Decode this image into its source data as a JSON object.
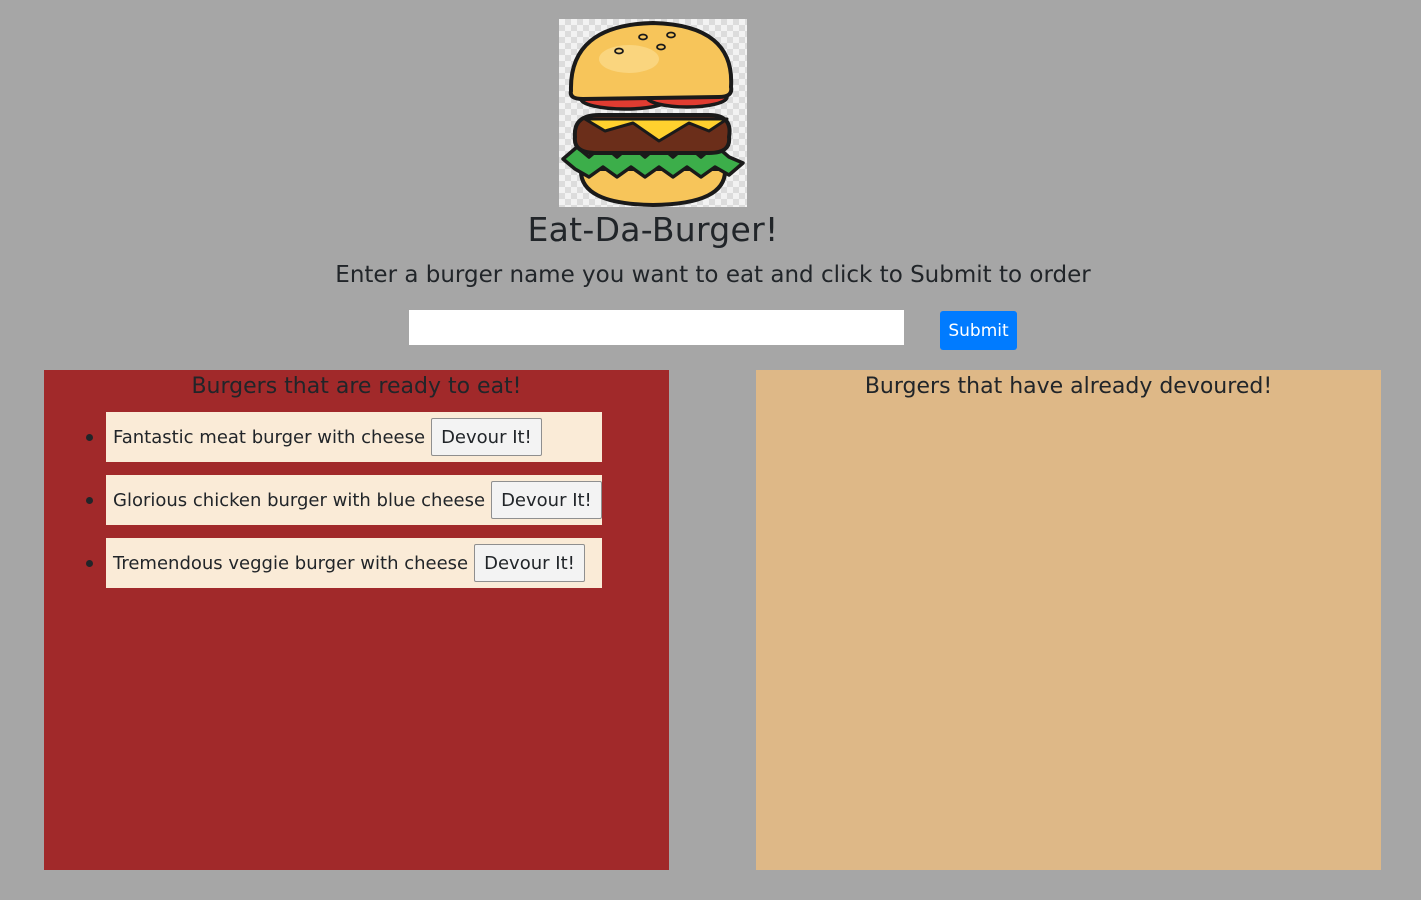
{
  "header": {
    "logo_icon": "burger-logo-icon",
    "title": "Eat-Da-Burger!",
    "subtitle": "Enter a burger name you want to eat and click to Submit to order"
  },
  "order_form": {
    "input_value": "",
    "input_placeholder": "",
    "submit_label": "Submit"
  },
  "ready_panel": {
    "heading": "Burgers that are ready to eat!",
    "background": "#a1292a",
    "items": [
      {
        "name": "Fantastic meat burger with cheese",
        "button_label": "Devour It!"
      },
      {
        "name": "Glorious chicken burger with blue cheese",
        "button_label": "Devour It!"
      },
      {
        "name": "Tremendous veggie burger with cheese",
        "button_label": "Devour It!"
      }
    ]
  },
  "devoured_panel": {
    "heading": "Burgers that have already devoured!",
    "background": "#deb887",
    "items": []
  },
  "colors": {
    "page_background": "#a6a6a6",
    "accent": "#007bff",
    "item_background": "#faebd7"
  }
}
